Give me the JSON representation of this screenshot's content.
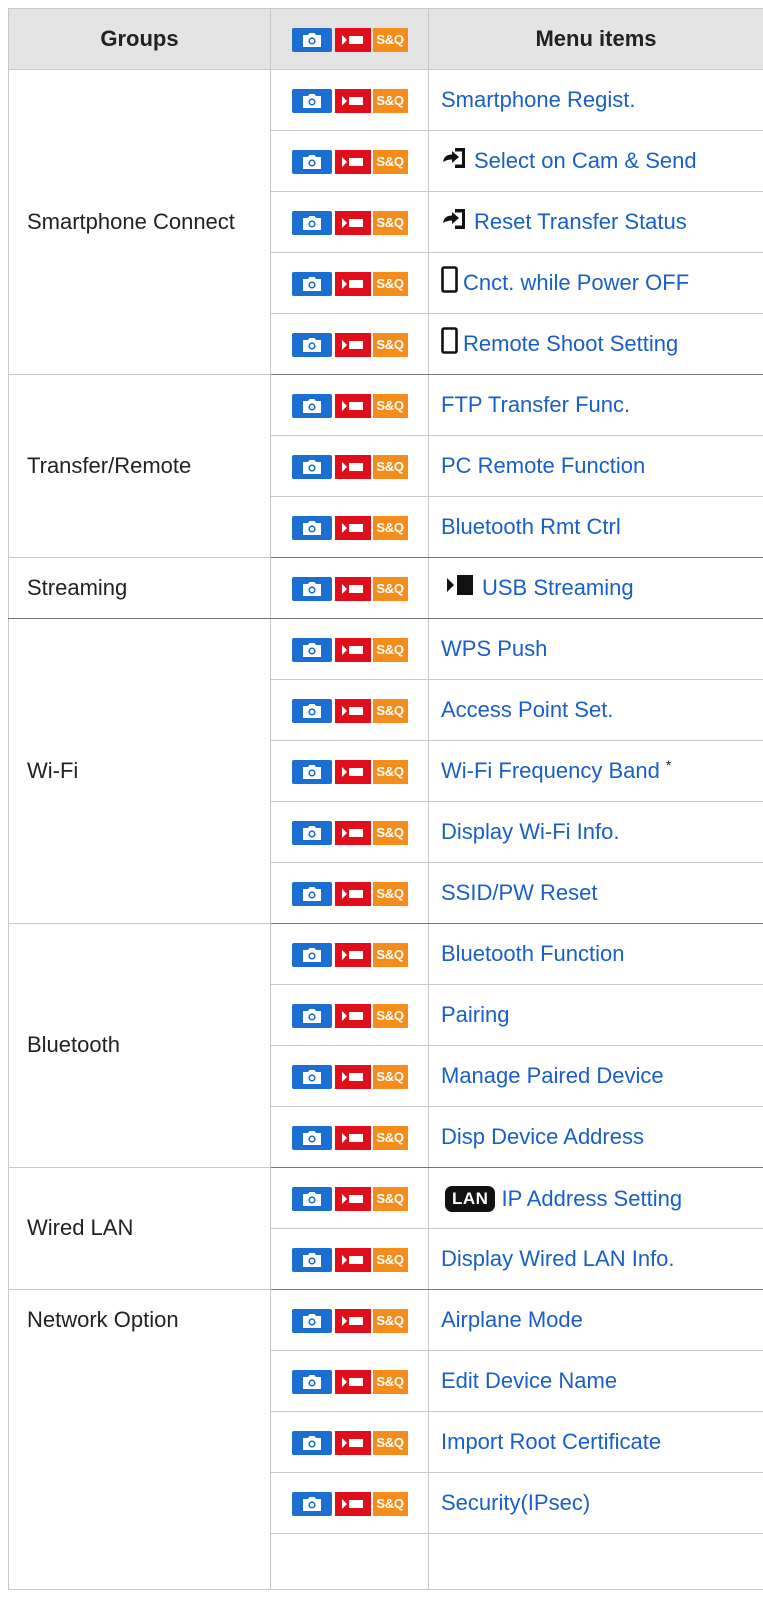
{
  "header": {
    "groups": "Groups",
    "menu_items": "Menu items",
    "mode_sq_label": "S&Q"
  },
  "icons": {
    "photo_mode": "camera-icon",
    "movie_mode": "movie-icon",
    "sq_mode": "s-and-q-icon",
    "send": "transfer-arrow-icon",
    "smartphone": "smartphone-icon",
    "streaming": "streaming-icon",
    "lan": "lan-badge-icon"
  },
  "colors": {
    "photo_mode": "#1a6fd0",
    "movie_mode": "#e00d1a",
    "sq_mode": "#f58d1c",
    "link": "#1a5fc7"
  },
  "lan_badge": "LAN",
  "footnote_mark": "*",
  "groups": [
    {
      "name": "Smartphone Connect",
      "items": [
        {
          "label": "Smartphone Regist."
        },
        {
          "label": "Select on Cam & Send",
          "icon": "send"
        },
        {
          "label": "Reset Transfer Status",
          "icon": "send"
        },
        {
          "label": "Cnct. while Power OFF",
          "icon": "smartphone"
        },
        {
          "label": "Remote Shoot Setting",
          "icon": "smartphone"
        }
      ]
    },
    {
      "name": "Transfer/Remote",
      "items": [
        {
          "label": "FTP Transfer Func."
        },
        {
          "label": "PC Remote Function"
        },
        {
          "label": "Bluetooth Rmt Ctrl"
        }
      ]
    },
    {
      "name": "Streaming",
      "items": [
        {
          "label": "USB Streaming",
          "icon": "streaming"
        }
      ]
    },
    {
      "name": "Wi-Fi",
      "items": [
        {
          "label": "WPS Push"
        },
        {
          "label": "Access Point Set."
        },
        {
          "label": "Wi-Fi Frequency Band",
          "note": true
        },
        {
          "label": "Display Wi-Fi Info."
        },
        {
          "label": "SSID/PW Reset"
        }
      ]
    },
    {
      "name": "Bluetooth",
      "items": [
        {
          "label": "Bluetooth Function"
        },
        {
          "label": "Pairing"
        },
        {
          "label": "Manage Paired Device"
        },
        {
          "label": "Disp Device Address"
        }
      ]
    },
    {
      "name": "Wired LAN",
      "items": [
        {
          "label": "IP Address Setting",
          "icon": "lan"
        },
        {
          "label": "Display Wired LAN Info."
        }
      ]
    },
    {
      "name": "Network Option",
      "top": true,
      "tail": true,
      "items": [
        {
          "label": "Airplane Mode"
        },
        {
          "label": "Edit Device Name"
        },
        {
          "label": "Import Root Certificate"
        },
        {
          "label": "Security(IPsec)"
        }
      ]
    }
  ]
}
